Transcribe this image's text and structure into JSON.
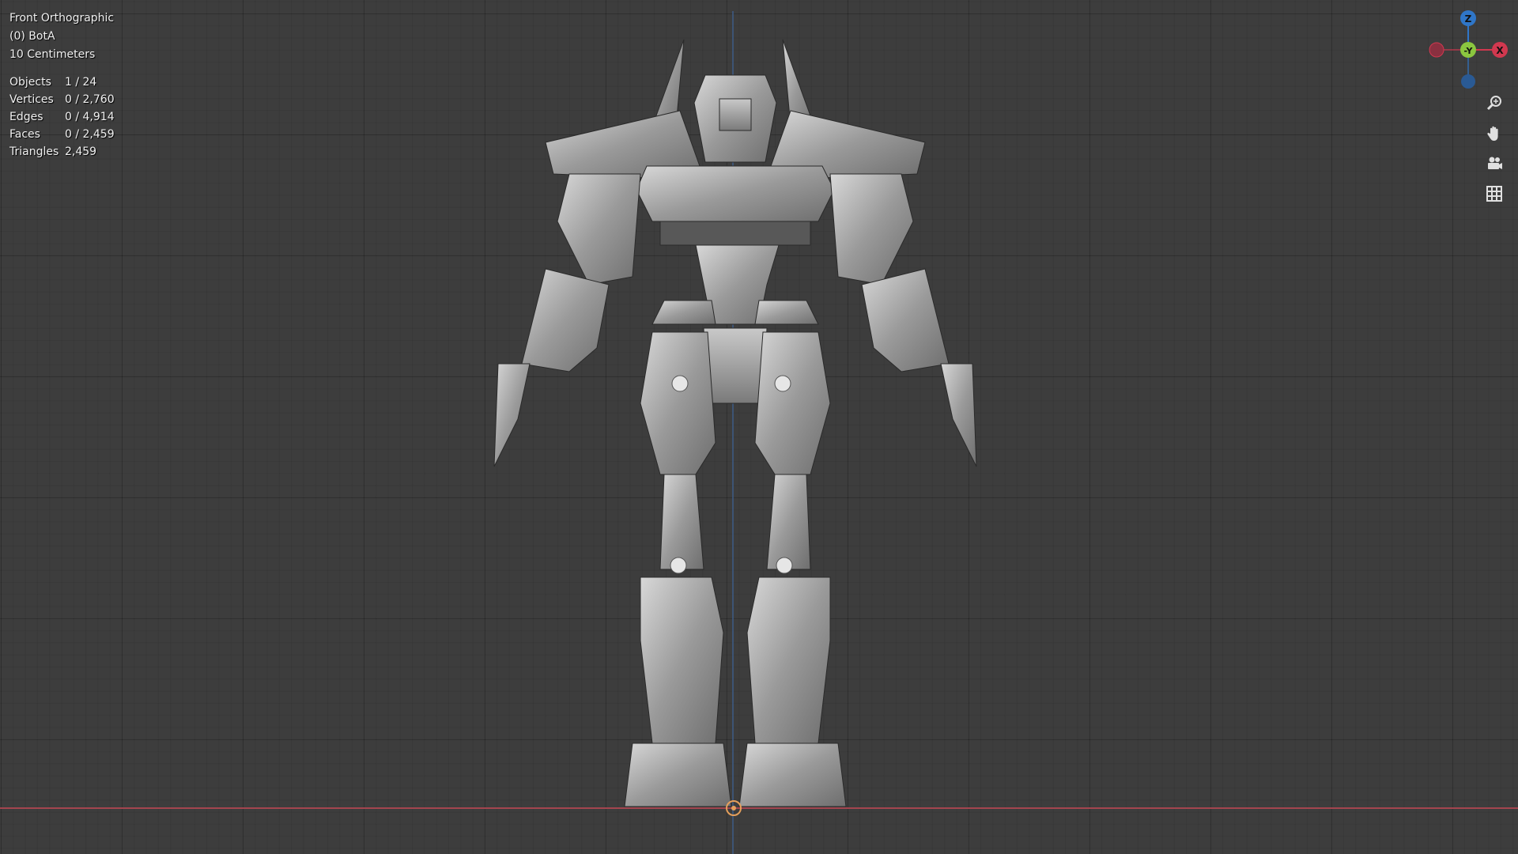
{
  "viewport": {
    "view_name": "Front Orthographic",
    "object_name": "(0) BotA",
    "scale": "10 Centimeters"
  },
  "stats": [
    {
      "label": "Objects",
      "value": "1 / 24"
    },
    {
      "label": "Vertices",
      "value": "0 / 2,760"
    },
    {
      "label": "Edges",
      "value": "0 / 4,914"
    },
    {
      "label": "Faces",
      "value": "0 / 2,459"
    },
    {
      "label": "Triangles",
      "value": "2,459"
    }
  ],
  "gizmo": {
    "z_label": "Z",
    "y_label": "-Y",
    "x_label": "X",
    "colors": {
      "z": "#2f76c8",
      "y": "#8bc63f",
      "x": "#d1384f"
    }
  },
  "nav_icons": [
    "zoom-icon",
    "hand-icon",
    "camera-icon",
    "grid-icon"
  ],
  "colors": {
    "background": "#3d3d3d",
    "x_axis": "#a3454f",
    "z_axis": "#3d5a82"
  }
}
